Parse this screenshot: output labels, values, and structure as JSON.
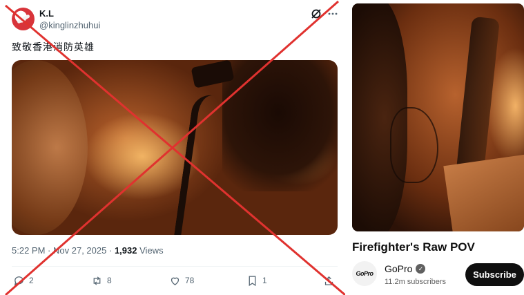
{
  "tweet": {
    "display_name": "K.L",
    "handle": "@kinglinzhuhui",
    "text": "致敬香港消防英雄",
    "time": "5:22 PM",
    "separator": "·",
    "date": "Nov 27, 2025",
    "views_count": "1,932",
    "views_label": "Views",
    "actions": {
      "replies": "2",
      "reposts": "8",
      "likes": "78",
      "bookmarks": "1"
    },
    "icons": [
      "grok-icon",
      "more-icon",
      "reply-icon",
      "repost-icon",
      "like-icon",
      "bookmark-icon",
      "share-icon"
    ]
  },
  "overlay": {
    "mark": "red-x",
    "color": "#e0322f"
  },
  "youtube": {
    "video_title": "Firefighter's Raw POV",
    "channel_name": "GoPro",
    "channel_logo_text": "GoPro",
    "subscribers": "11.2m subscribers",
    "subscribe_label": "Subscribe"
  },
  "colors": {
    "text_primary": "#0f1419",
    "text_secondary": "#536471",
    "subscribe_bg": "#0f0f0f"
  }
}
